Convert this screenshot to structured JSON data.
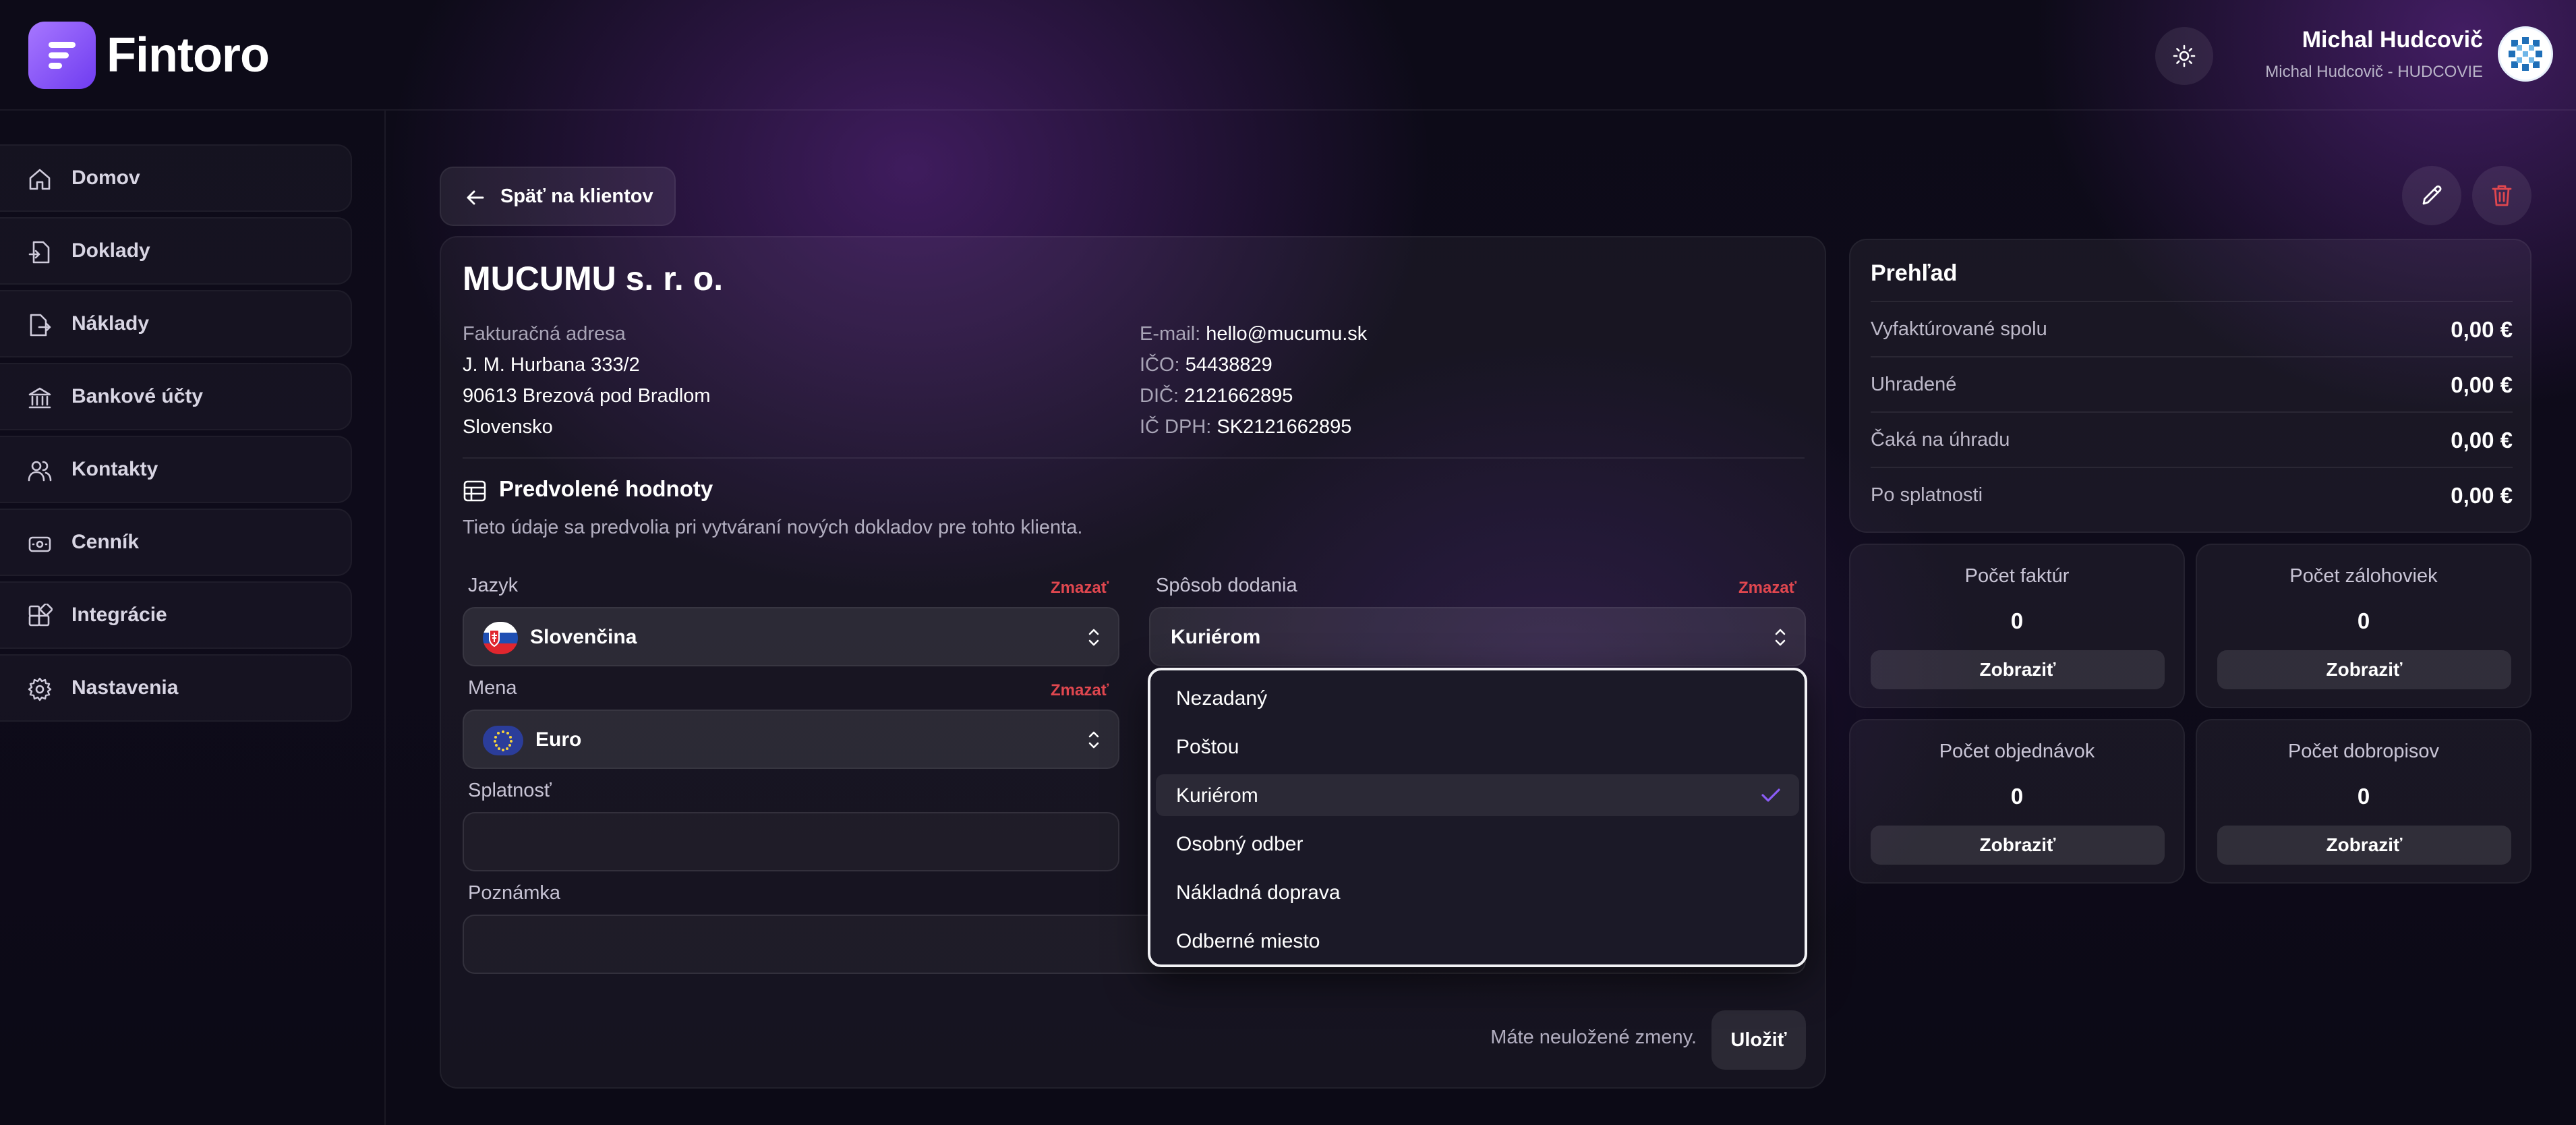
{
  "app": {
    "name": "Fintoro"
  },
  "header": {
    "user_name": "Michal Hudcovič",
    "user_company": "Michal Hudcovič - HUDCOVIE"
  },
  "sidebar": {
    "items": [
      {
        "label": "Domov",
        "icon": "home-icon"
      },
      {
        "label": "Doklady",
        "icon": "document-import-icon"
      },
      {
        "label": "Náklady",
        "icon": "document-export-icon"
      },
      {
        "label": "Bankové účty",
        "icon": "bank-icon"
      },
      {
        "label": "Kontakty",
        "icon": "users-icon"
      },
      {
        "label": "Cenník",
        "icon": "price-tag-icon"
      },
      {
        "label": "Integrácie",
        "icon": "integrations-icon"
      },
      {
        "label": "Nastavenia",
        "icon": "gear-icon"
      }
    ]
  },
  "back_button": {
    "label": "Späť na klientov"
  },
  "client": {
    "name": "MUCUMU s. r. o.",
    "billing_label": "Fakturačná adresa",
    "street": "J. M. Hurbana 333/2",
    "city": "90613 Brezová pod Bradlom",
    "country": "Slovensko",
    "email_label": "E-mail:",
    "email": "hello@mucumu.sk",
    "ico_label": "IČO:",
    "ico": "54438829",
    "dic_label": "DIČ:",
    "dic": "2121662895",
    "icdph_label": "IČ DPH:",
    "icdph": "SK2121662895"
  },
  "defaults": {
    "title": "Predvolené hodnoty",
    "description": "Tieto údaje sa predvolia pri vytváraní nových dokladov pre tohto klienta.",
    "language": {
      "label": "Jazyk",
      "value": "Slovenčina",
      "clear": "Zmazať"
    },
    "delivery": {
      "label": "Spôsob dodania",
      "value": "Kuriérom",
      "clear": "Zmazať"
    },
    "currency": {
      "label": "Mena",
      "value": "Euro",
      "clear": "Zmazať"
    },
    "due": {
      "label": "Splatnosť",
      "value": ""
    },
    "note": {
      "label": "Poznámka",
      "value": ""
    },
    "unsaved_text": "Máte neuložené zmeny.",
    "save_label": "Uložiť"
  },
  "delivery_dropdown": {
    "options": [
      "Nezadaný",
      "Poštou",
      "Kuriérom",
      "Osobný odber",
      "Nákladná doprava",
      "Odberné miesto"
    ],
    "selected": "Kuriérom"
  },
  "overview": {
    "title": "Prehľad",
    "rows": [
      {
        "label": "Vyfaktúrované spolu",
        "value": "0,00 €"
      },
      {
        "label": "Uhradené",
        "value": "0,00 €"
      },
      {
        "label": "Čaká na úhradu",
        "value": "0,00 €"
      },
      {
        "label": "Po splatnosti",
        "value": "0,00 €"
      }
    ]
  },
  "stats": [
    {
      "label": "Počet faktúr",
      "count": "0",
      "button": "Zobraziť"
    },
    {
      "label": "Počet zálohoviek",
      "count": "0",
      "button": "Zobraziť"
    },
    {
      "label": "Počet objednávok",
      "count": "0",
      "button": "Zobraziť"
    },
    {
      "label": "Počet dobropisov",
      "count": "0",
      "button": "Zobraziť"
    }
  ],
  "colors": {
    "accent": "#8b5cf6",
    "danger": "#e0474f",
    "background": "#0d0b18"
  }
}
